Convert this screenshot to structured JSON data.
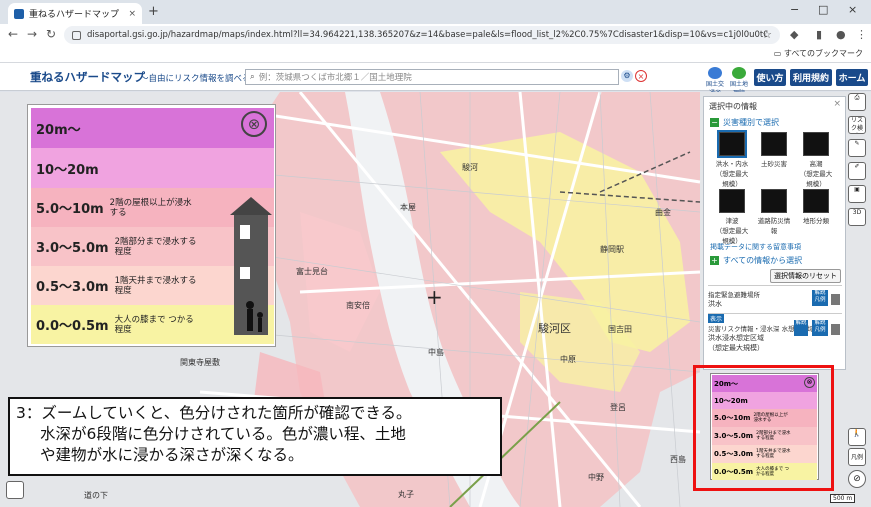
{
  "browser": {
    "tab_title": "重ねるハザードマップ",
    "tab_close": "×",
    "new_tab": "+",
    "url": "disaportal.gsi.go.jp/hazardmap/maps/index.html?ll=34.964221,138.365207&z=14&base=pale&ls=flood_list_l2%2C0.75%7Cdisaster1&disp=10&vs=c1j0l0u0t0h0z0",
    "all_bookmarks": "すべてのブックマーク",
    "minimize": "−",
    "maximize": "□",
    "close": "×"
  },
  "header": {
    "app_name": "重ねるハザードマップ",
    "app_sub": "～自由にリスク情報を調べる～",
    "search_placeholder": "例：茨城県つくば市北郷１／国土地理院",
    "logo1": "国土交通省",
    "logo2": "国土地理院",
    "usage_btn": "使い方",
    "terms_btn": "利用規約",
    "home_btn": "ホーム"
  },
  "map_labels": {
    "l1": "静岡駅",
    "l2": "駿河区",
    "l3": "中島",
    "l4": "中原",
    "l5": "西島",
    "l6": "登呂",
    "l7": "曲金",
    "l8": "道の下",
    "l9": "国吉田",
    "l10": "丸子",
    "l11": "駿河",
    "l12": "南安倍",
    "l13": "富士見台",
    "l14": "関東寺屋敷",
    "l15": "中野",
    "l16": "本屋"
  },
  "legend_big": {
    "rows": [
      {
        "value": "20m～",
        "desc": ""
      },
      {
        "value": "10～20m",
        "desc": ""
      },
      {
        "value": "5.0～10m",
        "desc": "2階の屋根以上が浸水する"
      },
      {
        "value": "3.0～5.0m",
        "desc": "2階部分まで浸水する程度"
      },
      {
        "value": "0.5～3.0m",
        "desc": "1階天井まで浸水する程度"
      },
      {
        "value": "0.0～0.5m",
        "desc": "大人の膝まで つかる程度"
      }
    ],
    "close": "⊗"
  },
  "panel": {
    "title": "選択中の情報",
    "close": "×",
    "by_type": "災害種別で選択",
    "hazards": [
      {
        "label": "洪水・内水",
        "sub": "（想定最大規模）"
      },
      {
        "label": "土砂災害",
        "sub": ""
      },
      {
        "label": "高潮",
        "sub": "（想定最大規模）"
      },
      {
        "label": "津波",
        "sub": "（想定最大規模）"
      },
      {
        "label": "道路防災情報",
        "sub": ""
      },
      {
        "label": "地形分類",
        "sub": ""
      }
    ],
    "notice_link": "掲載データに関する留意事項",
    "all_info": "すべての情報から選択",
    "reset": "選択情報のリセット",
    "item1_cat": "指定緊急避難場所",
    "item1_name": "洪水",
    "item1_legend": "解説 凡例",
    "item2_badge": "表示",
    "item2_text": "洪水浸水想定区域",
    "item2_sub": "（想定最大規模）",
    "item2_top": "災害リスク情報・浸水深 水想定区域",
    "item2_mode": "解説",
    "item2_legend": "解説 凡例"
  },
  "tools": [
    "印刷",
    "リスク検索",
    "作図",
    "ツール",
    "保存",
    "3D"
  ],
  "legend_small": {
    "rows": [
      {
        "value": "20m～",
        "desc": ""
      },
      {
        "value": "10～20m",
        "desc": ""
      },
      {
        "value": "5.0～10m",
        "desc": "2階の屋根以上が浸水する"
      },
      {
        "value": "3.0～5.0m",
        "desc": "2階部分まで浸水する程度"
      },
      {
        "value": "0.5～3.0m",
        "desc": "1階天井まで浸水する程度"
      },
      {
        "value": "0.0～0.5m",
        "desc": "大人の膝まで つかる程度"
      }
    ],
    "close": "⊗"
  },
  "annotation": {
    "line1": "3：ズームしていくと、色分けされた箇所が確認できる。",
    "line2": "水深が6段階に色分けされている。色が濃い程、土地",
    "line3": "や建物が水に浸かる深さが深くなる。"
  },
  "right_icons": [
    "凡例"
  ],
  "scale": "500 m",
  "colors": {
    "d20": "#d873d8",
    "d10": "#f0a3e0",
    "d5": "#f6b9c2",
    "d3": "#f8c7cc",
    "d05": "#fcd9d2",
    "d0": "#f8f4a6",
    "brand": "#1a4a8a",
    "frame": "#ee1111"
  }
}
